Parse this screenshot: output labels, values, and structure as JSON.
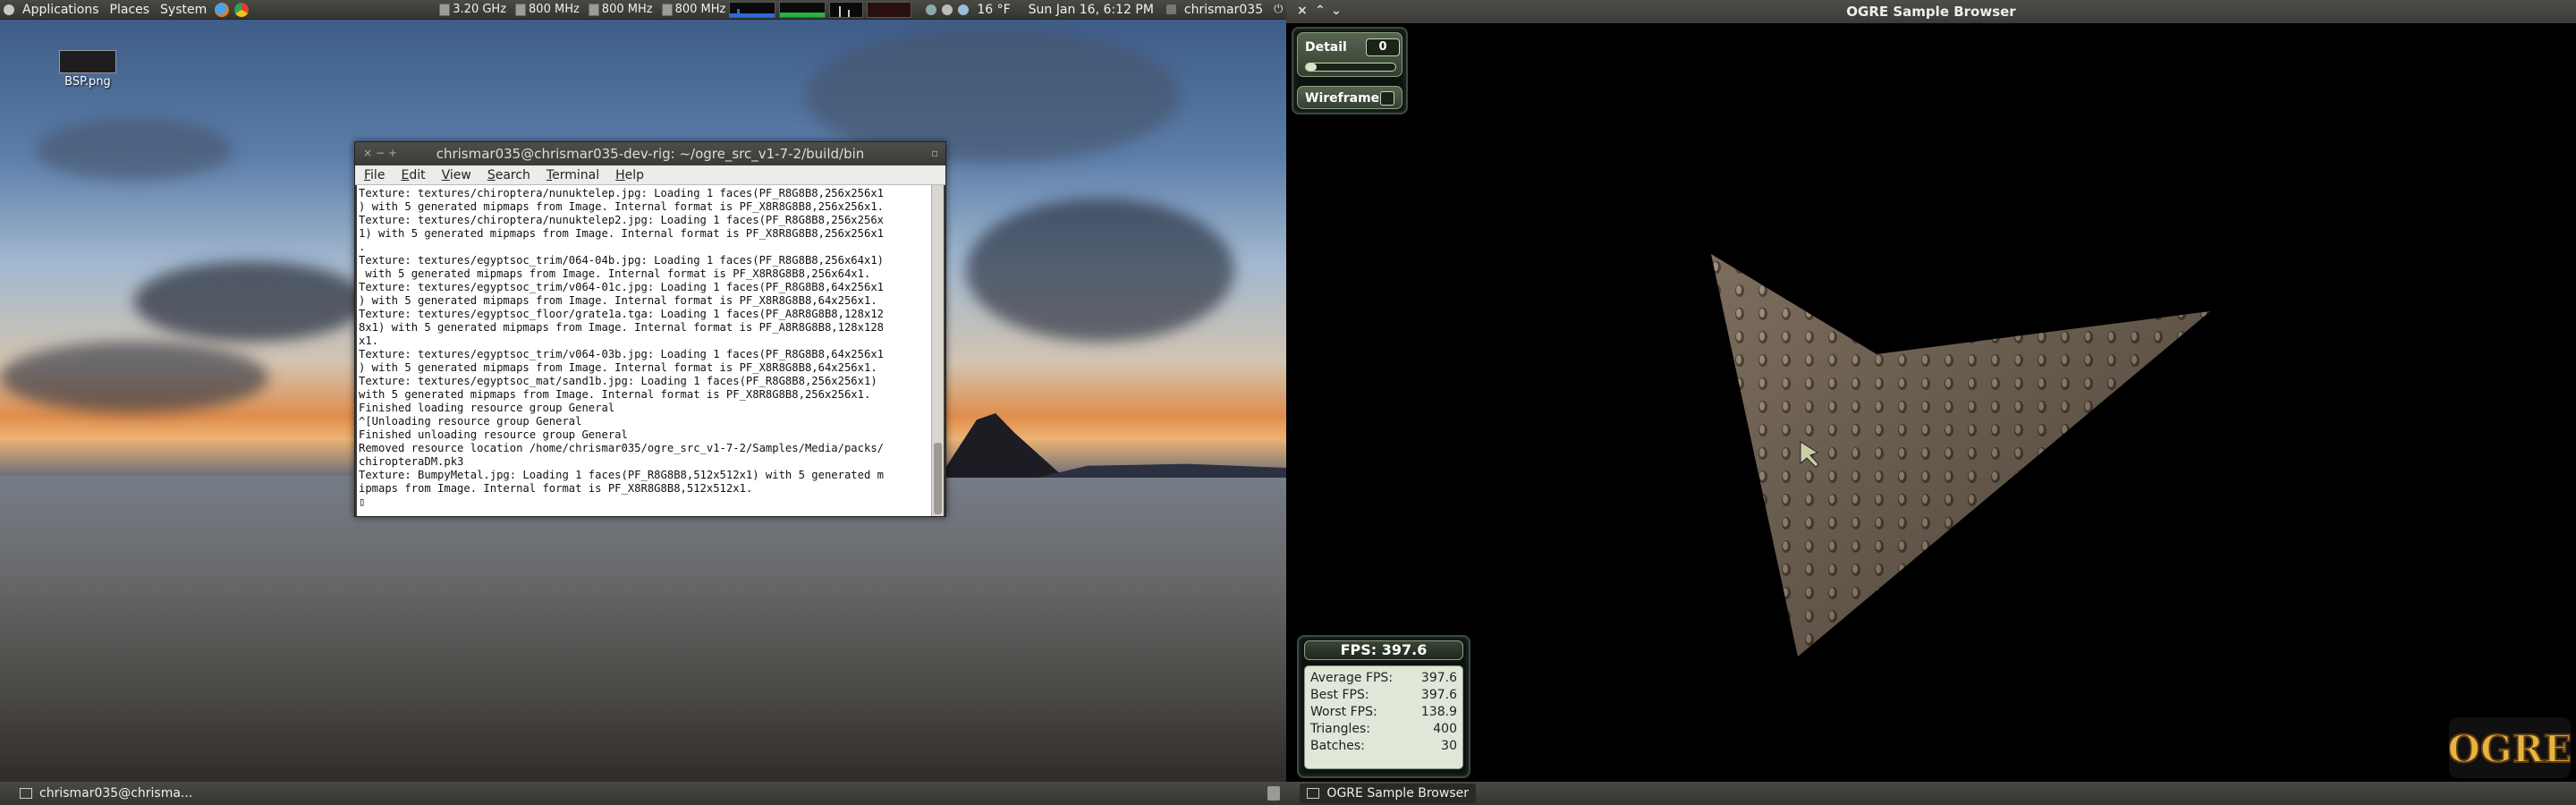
{
  "top_panel": {
    "menus": [
      "Applications",
      "Places",
      "System"
    ],
    "cpus": [
      "3.20 GHz",
      "800 MHz",
      "800 MHz",
      "800 MHz"
    ],
    "weather": "16 °F",
    "datetime": "Sun Jan 16,  6:12 PM",
    "user": "chrismar035"
  },
  "desktop": {
    "icon_label": "BSP.png"
  },
  "terminal": {
    "title": "chrismar035@chrismar035-dev-rig: ~/ogre_src_v1-7-2/build/bin",
    "menu": [
      "File",
      "Edit",
      "View",
      "Search",
      "Terminal",
      "Help"
    ],
    "lines": [
      "Texture: textures/chiroptera/nunuktelep.jpg: Loading 1 faces(PF_R8G8B8,256x256x1",
      ") with 5 generated mipmaps from Image. Internal format is PF_X8R8G8B8,256x256x1.",
      "Texture: textures/chiroptera/nunuktelep2.jpg: Loading 1 faces(PF_R8G8B8,256x256x",
      "1) with 5 generated mipmaps from Image. Internal format is PF_X8R8G8B8,256x256x1",
      ".",
      "Texture: textures/egyptsoc_trim/064-04b.jpg: Loading 1 faces(PF_R8G8B8,256x64x1)",
      " with 5 generated mipmaps from Image. Internal format is PF_X8R8G8B8,256x64x1.",
      "Texture: textures/egyptsoc_trim/v064-01c.jpg: Loading 1 faces(PF_R8G8B8,64x256x1",
      ") with 5 generated mipmaps from Image. Internal format is PF_X8R8G8B8,64x256x1.",
      "Texture: textures/egyptsoc_floor/grate1a.tga: Loading 1 faces(PF_A8R8G8B8,128x12",
      "8x1) with 5 generated mipmaps from Image. Internal format is PF_A8R8G8B8,128x128",
      "x1.",
      "Texture: textures/egyptsoc_trim/v064-03b.jpg: Loading 1 faces(PF_R8G8B8,64x256x1",
      ") with 5 generated mipmaps from Image. Internal format is PF_X8R8G8B8,64x256x1.",
      "Texture: textures/egyptsoc_mat/sand1b.jpg: Loading 1 faces(PF_R8G8B8,256x256x1)",
      "with 5 generated mipmaps from Image. Internal format is PF_X8R8G8B8,256x256x1.",
      "Finished loading resource group General",
      "^[Unloading resource group General",
      "Finished unloading resource group General",
      "Removed resource location /home/chrismar035/ogre_src_v1-7-2/Samples/Media/packs/",
      "chiropteraDM.pk3",
      "Texture: BumpyMetal.jpg: Loading 1 faces(PF_R8G8B8,512x512x1) with 5 generated m",
      "ipmaps from Image. Internal format is PF_X8R8G8B8,512x512x1."
    ]
  },
  "ogre": {
    "window_title": "OGRE Sample Browser",
    "detail_label": "Detail",
    "detail_value": "0",
    "detail_slider_fraction": 0.0,
    "wireframe_label": "Wireframe",
    "wireframe_checked": false,
    "fps_header": "FPS: 397.6",
    "stats": [
      {
        "label": "Average FPS:",
        "value": "397.6"
      },
      {
        "label": "Best FPS:",
        "value": "397.6"
      },
      {
        "label": "Worst FPS:",
        "value": "138.9"
      },
      {
        "label": "Triangles:",
        "value": "400"
      },
      {
        "label": "Batches:",
        "value": "30"
      }
    ],
    "logo_text": "OGRE"
  },
  "bottom_panel": {
    "tasks": [
      "chrismar035@chrisma...",
      "OGRE Sample Browser"
    ]
  },
  "colors": {
    "panel": "#3c3b37",
    "tray_border": "#3b4a40",
    "ogre_logo": "#e8b340"
  }
}
